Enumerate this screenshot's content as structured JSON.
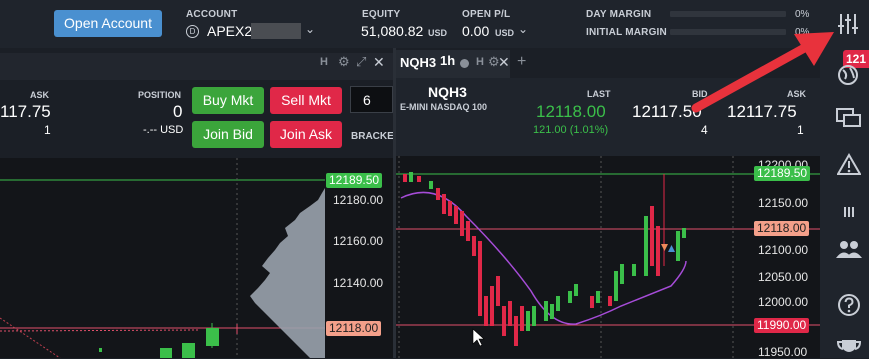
{
  "topbar": {
    "open_account_label": "Open Account",
    "account_label": "ACCOUNT",
    "account_value": "APEX2",
    "equity_label": "EQUITY",
    "equity_value": "51,080.82",
    "equity_currency": "USD",
    "openpl_label": "OPEN P/L",
    "openpl_value": "0.00",
    "openpl_currency": "USD",
    "day_margin_label": "DAY MARGIN",
    "day_margin_value": "0%",
    "initial_margin_label": "INITIAL MARGIN",
    "initial_margin_value": "0%"
  },
  "left_panel": {
    "ask_label": "ASK",
    "ask_value": "117.75",
    "ask_size": "1",
    "position_label": "POSITION",
    "position_value": "0",
    "position_usd": "-.-- USD",
    "buy_mkt": "Buy Mkt",
    "sell_mkt": "Sell Mkt",
    "join_bid": "Join Bid",
    "join_ask": "Join Ask",
    "qty": "6",
    "bracket_label": "BRACKET",
    "head_h": "H",
    "prices": [
      "12180.00",
      "12160.00",
      "12140.00"
    ],
    "tag_top": "12189.50",
    "tag_bottom": "12118.00"
  },
  "right_panel": {
    "tab_symbol": "NQH3",
    "tab_interval": "1h",
    "add_tab": "+",
    "head_h": "H",
    "symbol": "NQH3",
    "description": "E-MINI NASDAQ 100",
    "last_label": "LAST",
    "last_value": "12118.00",
    "last_change": "121.00 (1.01%)",
    "bid_label": "BID",
    "bid_value": "12117.50",
    "bid_size": "4",
    "ask_label": "ASK",
    "ask_value": "12117.75",
    "ask_size": "1",
    "prices": [
      "12200.00",
      "12150.00",
      "12100.00",
      "12050.00",
      "12000.00",
      "11950.00"
    ],
    "tag_top": "12189.50",
    "tag_mid": "12118.00",
    "tag_low": "11990.00"
  },
  "rail": {
    "badge": "121",
    "icons": [
      "sliders-icon",
      "globe-icon",
      "chat-icon",
      "alert-icon",
      "bars-icon",
      "users-icon",
      "help-icon",
      "trophy-icon"
    ]
  },
  "colors": {
    "accent_blue": "#4a90d0",
    "buy_green": "#3ba53b",
    "sell_red": "#e02848",
    "arrow_red": "#e8323c"
  }
}
